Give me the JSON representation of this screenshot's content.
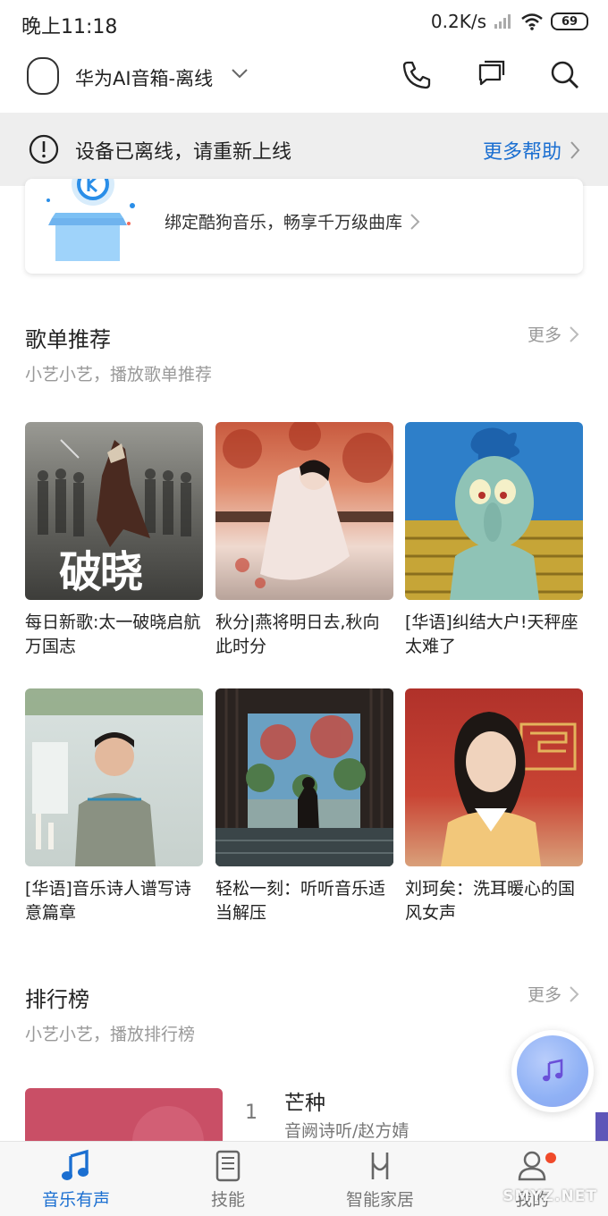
{
  "status_bar": {
    "time": "晚上11:18",
    "network_speed": "0.2K/s",
    "battery": "69"
  },
  "header": {
    "device_name": "华为AI音箱-离线"
  },
  "offline_banner": {
    "message": "设备已离线，请重新上线",
    "help_label": "更多帮助"
  },
  "promo": {
    "text": "绑定酷狗音乐，畅享千万级曲库"
  },
  "playlists": {
    "title": "歌单推荐",
    "subtitle": "小艺小艺，播放歌单推荐",
    "more_label": "更多",
    "items": [
      {
        "title": "每日新歌:太一破晓启航万国志",
        "cover_text": "破晓"
      },
      {
        "title": "秋分|燕将明日去,秋向此时分"
      },
      {
        "title": "[华语]纠结大户!天秤座太难了"
      },
      {
        "title": "[华语]音乐诗人谱写诗意篇章"
      },
      {
        "title": "轻松一刻：听听音乐适当解压"
      },
      {
        "title": "刘珂矣：洗耳暖心的国风女声"
      }
    ]
  },
  "charts": {
    "title": "排行榜",
    "subtitle": "小艺小艺，播放排行榜",
    "more_label": "更多",
    "items": [
      {
        "rank": "1",
        "song": "芒种",
        "artist": "音阙诗听/赵方婧"
      }
    ]
  },
  "bottom_nav": {
    "items": [
      {
        "label": "音乐有声",
        "icon": "music-note-icon",
        "active": true
      },
      {
        "label": "技能",
        "icon": "book-icon",
        "active": false
      },
      {
        "label": "智能家居",
        "icon": "smart-home-icon",
        "active": false
      },
      {
        "label": "我的",
        "icon": "person-icon",
        "active": false
      }
    ]
  },
  "watermark": "SMYZ.NET",
  "colors": {
    "accent": "#1b6fd1",
    "banner_bg": "#eeeeee",
    "badge_red": "#f04a2a"
  }
}
